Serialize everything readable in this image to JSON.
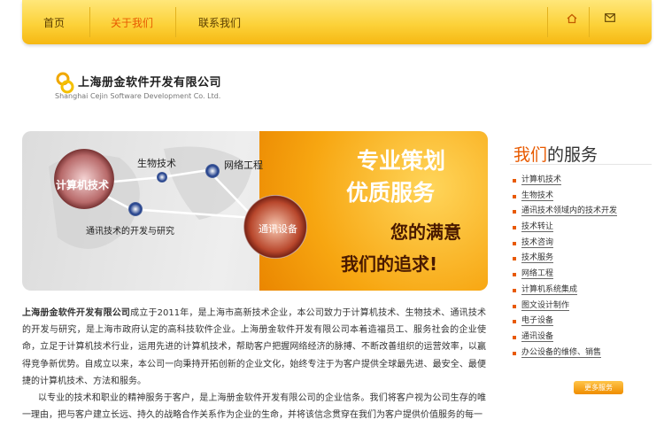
{
  "nav": {
    "home": "首页",
    "about": "关于我们",
    "contact": "联系我们",
    "home_icon": "house-icon",
    "mail_icon": "mail-icon"
  },
  "logo": {
    "cn": "上海册金软件开发有限公司",
    "en": "Shanghai Cejin Software Development Co. Ltd."
  },
  "banner": {
    "nodes": [
      "计算机技术",
      "生物技术",
      "网络工程",
      "通讯技术的开发与研究",
      "通讯设备"
    ],
    "slogan1": "专业策划",
    "slogan2": "优质服务",
    "slogan3": "您的满意",
    "slogan4": "我们的追求!"
  },
  "services": {
    "title_highlight": "我们",
    "title_rest": "的服务",
    "items": [
      "计算机技术",
      "生物技术",
      "通讯技术领域内的技术开发",
      "技术转让",
      "技术咨询",
      "技术服务",
      "网络工程",
      "计算机系统集成",
      "图文设计制作",
      "电子设备",
      "通讯设备",
      "办公设备的维修、销售"
    ],
    "more": "更多服务"
  },
  "intro": {
    "company": "上海册金软件开发有限公司",
    "p1": "成立于2011年，是上海市高新技术企业，本公司致力于计算机技术、生物技术、通讯技术的开发与研究，是上海市政府认定的高科技软件企业。上海册金软件开发有限公司本着造福员工、服务社会的企业使命，立足于计算机技术行业，运用先进的计算机技术，帮助客户把握网络经济的脉搏、不断改善组织的运营效率，以赢得竞争新优势。自成立以来，本公司一向秉持开拓创新的企业文化，始终专注于为客户提供全球最先进、最安全、最便捷的计算机技术、方法和服务。",
    "p2": "以专业的技术和职业的精神服务于客户，是上海册金软件开发有限公司的企业信条。我们将客户视为公司生存的唯一理由，把与客户建立长远、持久的战略合作关系作为企业的生命，并将该信念贯穿在我们为客户提供价值服务的每一"
  },
  "colors": {
    "accent": "#e85a00",
    "bar_gold": "#fcd23a"
  }
}
